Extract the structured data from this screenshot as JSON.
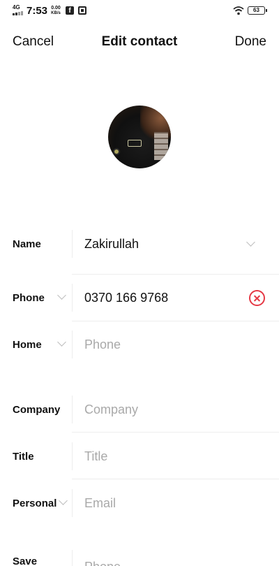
{
  "status_bar": {
    "network": "4G",
    "time": "7:53",
    "speed_value": "0.00",
    "speed_unit": "KB/s",
    "battery": "63"
  },
  "header": {
    "cancel_label": "Cancel",
    "title": "Edit contact",
    "done_label": "Done"
  },
  "form": {
    "name": {
      "label": "Name",
      "value": "Zakirullah"
    },
    "phone": {
      "label": "Phone",
      "value": "0370 166 9768"
    },
    "home": {
      "label": "Home",
      "placeholder": "Phone"
    },
    "company": {
      "label": "Company",
      "placeholder": "Company"
    },
    "title": {
      "label": "Title",
      "placeholder": "Title"
    },
    "personal": {
      "label": "Personal",
      "placeholder": "Email"
    },
    "save": {
      "label": "Save",
      "placeholder": "Phone"
    }
  },
  "colors": {
    "accent_red": "#e53945",
    "placeholder": "#a9a9a9",
    "divider": "#ededed"
  }
}
